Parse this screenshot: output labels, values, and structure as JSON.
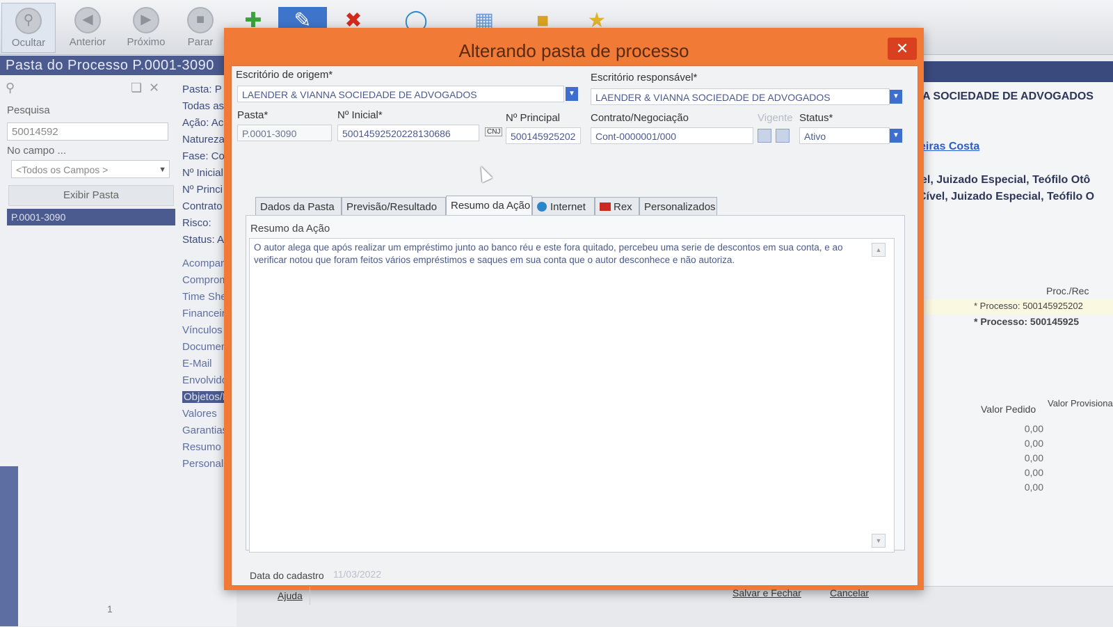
{
  "toolbar": {
    "buttons": [
      {
        "label": "Ocultar",
        "icon": "magnifier-icon"
      },
      {
        "label": "Anterior",
        "icon": "arrow-left-icon"
      },
      {
        "label": "Próximo",
        "icon": "arrow-right-icon"
      },
      {
        "label": "Parar",
        "icon": "stop-icon"
      }
    ],
    "icons": [
      "add-icon",
      "edit-icon",
      "delete-icon",
      "globe-icon",
      "chart-icon",
      "folder-icon",
      "tag-icon"
    ]
  },
  "left_panel": {
    "title": "Pasta do Processo P.0001-3090",
    "search_label": "Pesquisa",
    "search_value": "50014592",
    "field_label": "No campo ...",
    "field_select": "<Todos os Campos >",
    "show_button": "Exibir Pasta",
    "selected_item": "P.0001-3090"
  },
  "mid_column": {
    "fields": [
      "Pasta: P",
      "Todas as",
      "Ação: Ac",
      "Natureza",
      "Fase: Co",
      "Nº Inicial",
      "Nº Princi",
      "Contrato",
      "Risco:",
      "Status: A"
    ],
    "menu": [
      "Acompan",
      "Comprom",
      "Time She",
      "Financeir",
      "Vínculos",
      "Documen",
      "E-Mail",
      "Envolvido",
      "Objetos/F",
      "Valores",
      "Garantias",
      "Resumo d",
      "Personali"
    ]
  },
  "right_area": {
    "firm": "A SOCIEDADE DE ADVOGADOS",
    "link": "eiras Costa",
    "line1": "el, Juizado Especial, Teófilo Otô",
    "line2": "Cível, Juizado Especial, Teófilo O",
    "col_proc": "Proc./Rec",
    "proc1": "* Processo: 500145925202",
    "proc2": "* Processo: 500145925",
    "col_valor_pedido": "Valor Pedido",
    "col_valor_provisionado": "Valor Provisiona",
    "values": [
      "0,00",
      "0,00",
      "0,00",
      "0,00",
      "0,00"
    ]
  },
  "modal": {
    "title": "Alterando pasta de processo",
    "escritorio_origem_label": "Escritório de origem*",
    "escritorio_origem_value": "LAENDER & VIANNA SOCIEDADE DE ADVOGADOS",
    "escritorio_resp_label": "Escritório responsável*",
    "escritorio_resp_value": "LAENDER & VIANNA SOCIEDADE DE ADVOGADOS",
    "pasta_label": "Pasta*",
    "pasta_value": "P.0001-3090",
    "n_inicial_label": "Nº Inicial*",
    "n_inicial_value": "50014592520228130686",
    "cnj_label": "CNJ",
    "n_principal_label": "Nº Principal",
    "n_principal_value": "500145925202",
    "contrato_label": "Contrato/Negociação",
    "contrato_value": "Cont-0000001/000",
    "vigente_label": "Vigente",
    "status_label": "Status*",
    "status_value": "Ativo",
    "tabs": [
      "Dados da Pasta",
      "Previsão/Resultado",
      "Resumo da Ação",
      "Internet",
      "Rex",
      "Personalizados"
    ],
    "resumo_label": "Resumo da Ação",
    "resumo_text": "O autor alega que após realizar um empréstimo junto ao banco réu e este fora quitado, percebeu uma serie de descontos em sua conta, e ao verificar notou que foram feitos vários empréstimos e saques em sua conta que o autor desconhece e não autoriza.",
    "data_cadastro_label": "Data do cadastro",
    "data_cadastro_value": "11/03/2022",
    "help_button": "Ajuda",
    "save_button": "Salvar e Fechar",
    "cancel_button": "Cancelar"
  },
  "pagination": {
    "page": "1"
  }
}
